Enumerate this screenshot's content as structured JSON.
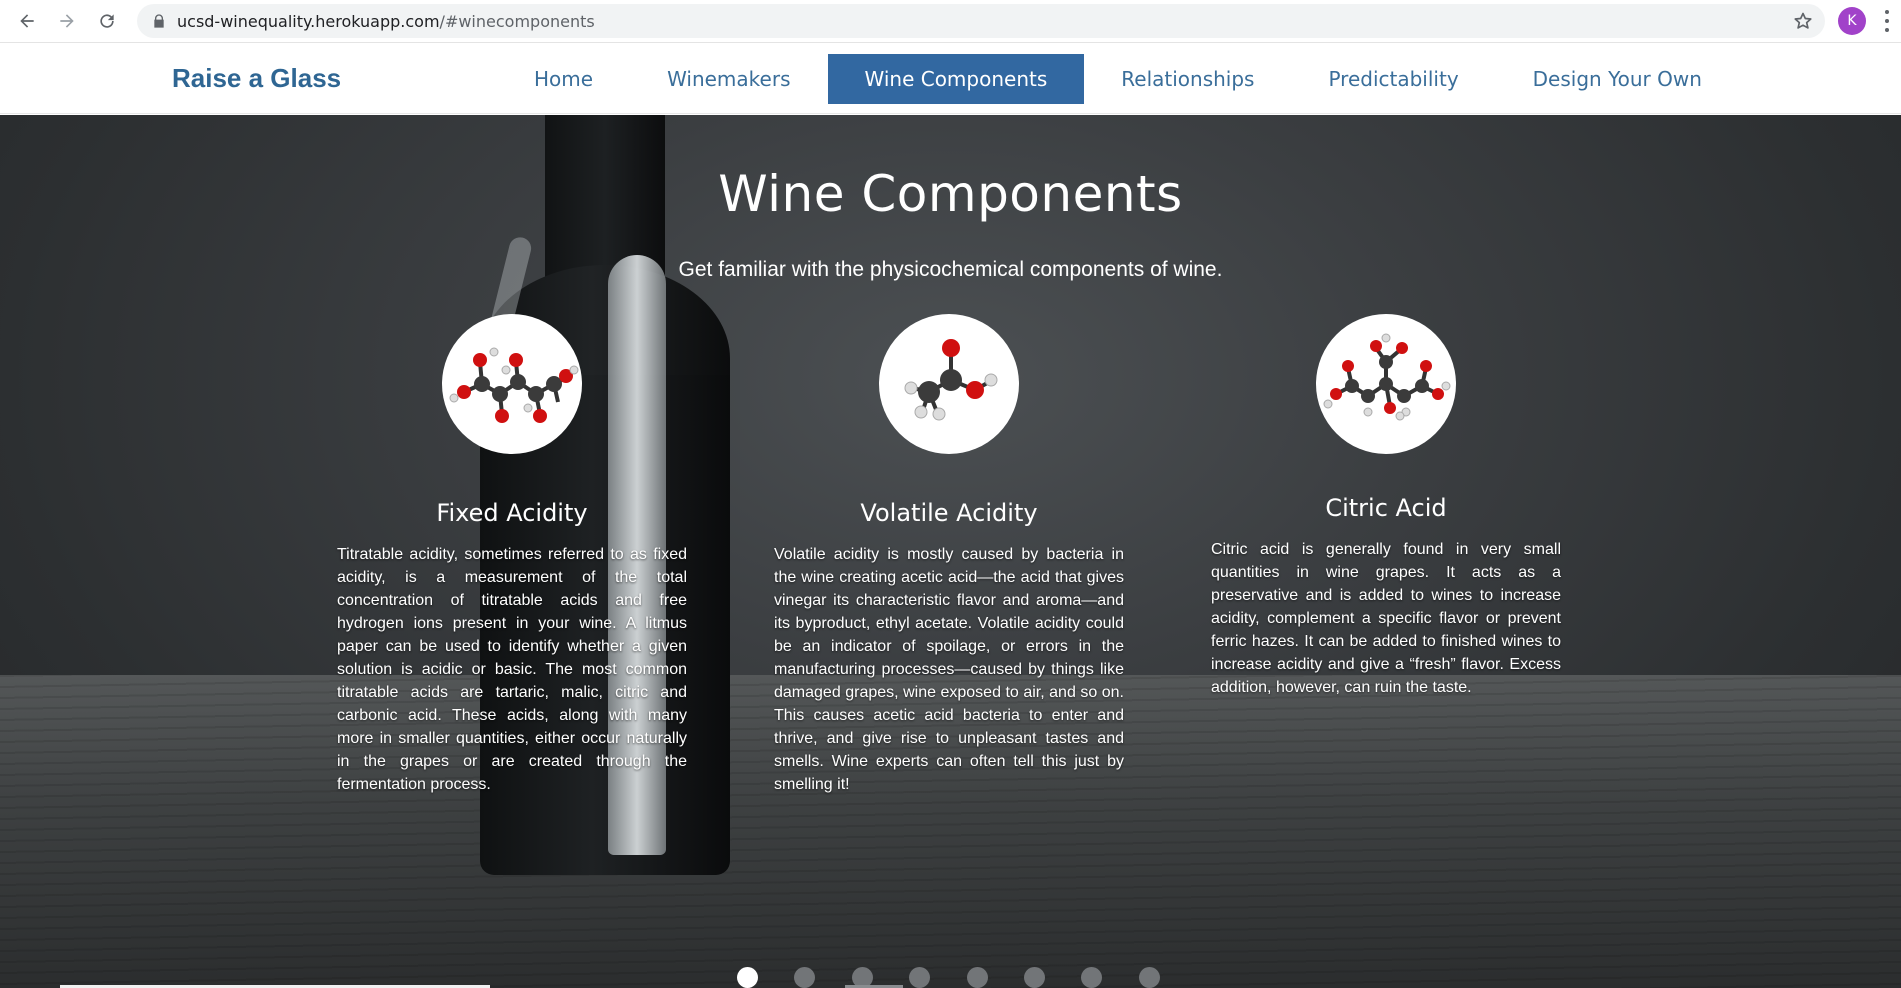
{
  "browser": {
    "url_host": "ucsd-winequality.herokuapp.com",
    "url_path": "/#winecomponents",
    "avatar_letter": "K",
    "icons": [
      "back-icon",
      "forward-icon",
      "reload-icon",
      "lock-icon",
      "star-icon",
      "menu-icon"
    ]
  },
  "site": {
    "brand": "Raise a Glass",
    "nav": [
      {
        "label": "Home",
        "active": false
      },
      {
        "label": "Winemakers",
        "active": false
      },
      {
        "label": "Wine Components",
        "active": true
      },
      {
        "label": "Relationships",
        "active": false
      },
      {
        "label": "Predictability",
        "active": false
      },
      {
        "label": "Design Your Own",
        "active": false
      }
    ]
  },
  "hero": {
    "title": "Wine Components",
    "subtitle": "Get familiar with the physicochemical components of wine.",
    "cards": [
      {
        "title": "Fixed Acidity",
        "body": "Titratable acidity, sometimes referred to as fixed acidity, is a measurement of the total concentration of titratable acids and free hydrogen ions present in your wine. A litmus paper can be used to identify whether a given solution is acidic or basic. The most common titratable acids are tartaric, malic, citric and carbonic acid. These acids, along with many more in smaller quantities, either occur naturally in the grapes or are created through the fermentation process."
      },
      {
        "title": "Volatile Acidity",
        "body": "Volatile acidity is mostly caused by bacteria in the wine creating acetic acid—the acid that gives vinegar its characteristic flavor and aroma—and its byproduct, ethyl acetate. Volatile acidity could be an indicator of spoilage, or errors in the manufacturing processes—caused by things like damaged grapes, wine exposed to air, and so on. This causes acetic acid bacteria to enter and thrive, and give rise to unpleasant tastes and smells. Wine experts can often tell this just by smelling it!"
      },
      {
        "title": "Citric Acid",
        "body": "Citric acid is generally found in very small quantities in wine grapes. It acts as a preservative and is added to wines to increase acidity, complement a specific flavor or prevent ferric hazes. It can be added to finished wines to increase acidity and give a “fresh” flavor. Excess addition, however, can ruin the taste."
      }
    ],
    "carousel_count": 8,
    "carousel_active": 0
  },
  "colors": {
    "brand": "#2f6693",
    "nav_active_bg": "#3268a1",
    "avatar": "#a142c9"
  }
}
